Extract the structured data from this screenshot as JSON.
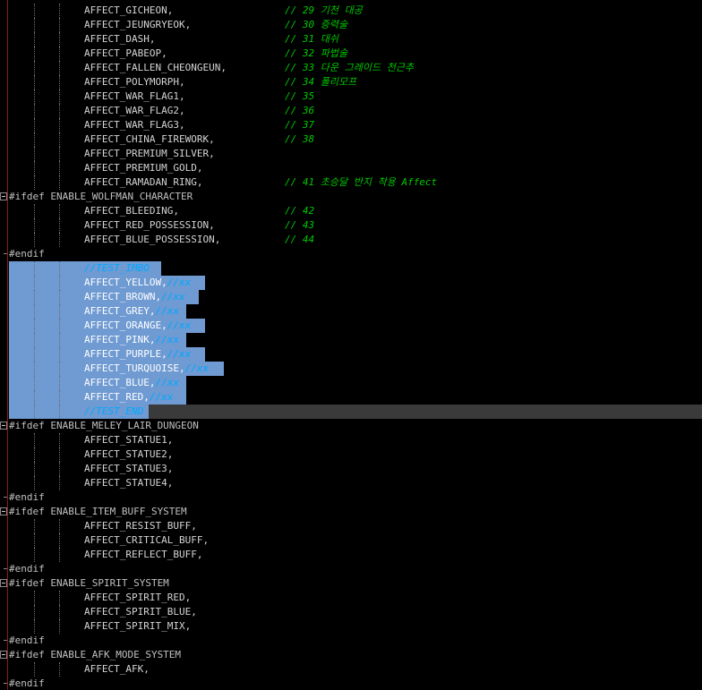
{
  "editor": {
    "lines": {
      "l0": {
        "code": "AFFECT_GICHEON,",
        "comment": "// 29 기천 대공"
      },
      "l1": {
        "code": "AFFECT_JEUNGRYEOK,",
        "comment": "// 30 증력술"
      },
      "l2": {
        "code": "AFFECT_DASH,",
        "comment": "// 31 대쉬"
      },
      "l3": {
        "code": "AFFECT_PABEOP,",
        "comment": "// 32 파법술"
      },
      "l4": {
        "code": "AFFECT_FALLEN_CHEONGEUN,",
        "comment": "// 33 다운 그레이드 천근추"
      },
      "l5": {
        "code": "AFFECT_POLYMORPH,",
        "comment": "// 34 폴리모프"
      },
      "l6": {
        "code": "AFFECT_WAR_FLAG1,",
        "comment": "// 35"
      },
      "l7": {
        "code": "AFFECT_WAR_FLAG2,",
        "comment": "// 36"
      },
      "l8": {
        "code": "AFFECT_WAR_FLAG3,",
        "comment": "// 37"
      },
      "l9": {
        "code": "AFFECT_CHINA_FIREWORK,",
        "comment": "// 38"
      },
      "l10": {
        "code": "AFFECT_PREMIUM_SILVER,"
      },
      "l11": {
        "code": "AFFECT_PREMIUM_GOLD,"
      },
      "l12": {
        "code": "AFFECT_RAMADAN_RING,",
        "comment": "// 41 초승달 반지 착용 Affect"
      },
      "l13": {
        "pre": "#ifdef ENABLE_WOLFMAN_CHARACTER"
      },
      "l14": {
        "code": "AFFECT_BLEEDING,",
        "comment": "// 42"
      },
      "l15": {
        "code": "AFFECT_RED_POSSESSION,",
        "comment": "// 43"
      },
      "l16": {
        "code": "AFFECT_BLUE_POSSESSION,",
        "comment": "// 44"
      },
      "l17": {
        "pre": "#endif"
      },
      "l18": {
        "comment": "//TEST_IMBO"
      },
      "l19": {
        "code": "AFFECT_YELLOW,",
        "comment": "//xx"
      },
      "l20": {
        "code": "AFFECT_BROWN,",
        "comment": "//xx"
      },
      "l21": {
        "code": "AFFECT_GREY,",
        "comment": "//xx"
      },
      "l22": {
        "code": "AFFECT_ORANGE,",
        "comment": "//xx"
      },
      "l23": {
        "code": "AFFECT_PINK,",
        "comment": "//xx"
      },
      "l24": {
        "code": "AFFECT_PURPLE,",
        "comment": "//xx"
      },
      "l25": {
        "code": "AFFECT_TURQUOISE,",
        "comment": "//xx"
      },
      "l26": {
        "code": "AFFECT_BLUE,",
        "comment": "//xx"
      },
      "l27": {
        "code": "AFFECT_RED,",
        "comment": "//xx"
      },
      "l28": {
        "comment": "//TEST_END"
      },
      "l29": {
        "pre": "#ifdef ENABLE_MELEY_LAIR_DUNGEON"
      },
      "l30": {
        "code": "AFFECT_STATUE1,"
      },
      "l31": {
        "code": "AFFECT_STATUE2,"
      },
      "l32": {
        "code": "AFFECT_STATUE3,"
      },
      "l33": {
        "code": "AFFECT_STATUE4,"
      },
      "l34": {
        "pre": "#endif"
      },
      "l35": {
        "pre": "#ifdef ENABLE_ITEM_BUFF_SYSTEM"
      },
      "l36": {
        "code": "AFFECT_RESIST_BUFF,"
      },
      "l37": {
        "code": "AFFECT_CRITICAL_BUFF,"
      },
      "l38": {
        "code": "AFFECT_REFLECT_BUFF,"
      },
      "l39": {
        "pre": "#endif"
      },
      "l40": {
        "pre": "#ifdef ENABLE_SPIRIT_SYSTEM"
      },
      "l41": {
        "code": "AFFECT_SPIRIT_RED,"
      },
      "l42": {
        "code": "AFFECT_SPIRIT_BLUE,"
      },
      "l43": {
        "code": "AFFECT_SPIRIT_MIX,"
      },
      "l44": {
        "pre": "#endif"
      },
      "l45": {
        "pre": "#ifdef ENABLE_AFK_MODE_SYSTEM"
      },
      "l46": {
        "code": "AFFECT_AFK,"
      },
      "l47": {
        "pre": "#endif"
      }
    }
  },
  "colors": {
    "background": "#000000",
    "code_text": "#d4d4d4",
    "comment_text": "#00c800",
    "selection": "#6f9ad2",
    "current_line": "#3a3a3a",
    "margin_line": "#8b1a1a"
  }
}
